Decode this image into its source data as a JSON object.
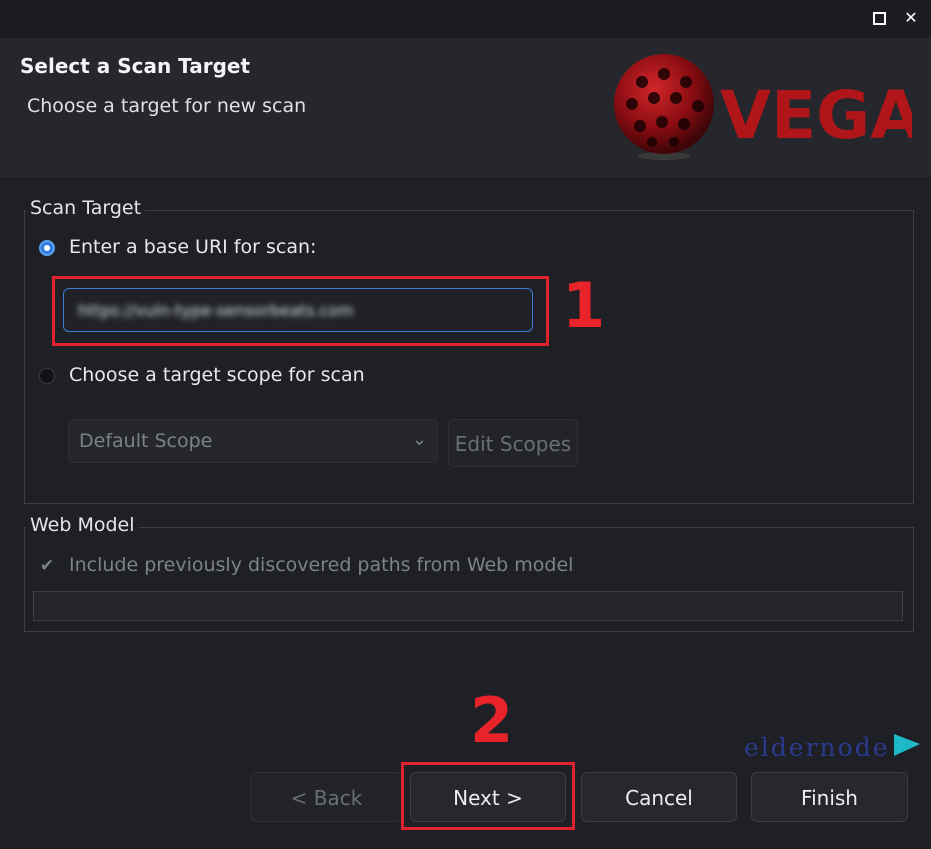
{
  "window": {
    "maximize_icon": "maximize-icon",
    "close_glyph": "✕"
  },
  "header": {
    "title": "Select a Scan Target",
    "subtitle": "Choose a target for new scan",
    "logo_text": "VEGA",
    "logo_color": "#b0151a"
  },
  "scan_target": {
    "group_label": "Scan Target",
    "option_uri_label": "Enter a base URI for scan:",
    "option_uri_selected": true,
    "uri_value": "https://vuln-type-sensorbeats.com",
    "option_scope_label": "Choose a target scope for scan",
    "option_scope_selected": false,
    "scope_select_value": "Default Scope",
    "edit_scopes_label": "Edit Scopes"
  },
  "web_model": {
    "group_label": "Web Model",
    "include_paths_label": "Include previously discovered paths from Web model",
    "include_paths_checked": true
  },
  "annotations": {
    "step1": "1",
    "step2": "2",
    "highlight_color": "#e0232a"
  },
  "footer": {
    "back_label": "< Back",
    "next_label": "Next >",
    "cancel_label": "Cancel",
    "finish_label": "Finish"
  },
  "watermark": {
    "text": "eldernode",
    "color": "#2a3a8c",
    "accent_color": "#1fb8c8"
  }
}
